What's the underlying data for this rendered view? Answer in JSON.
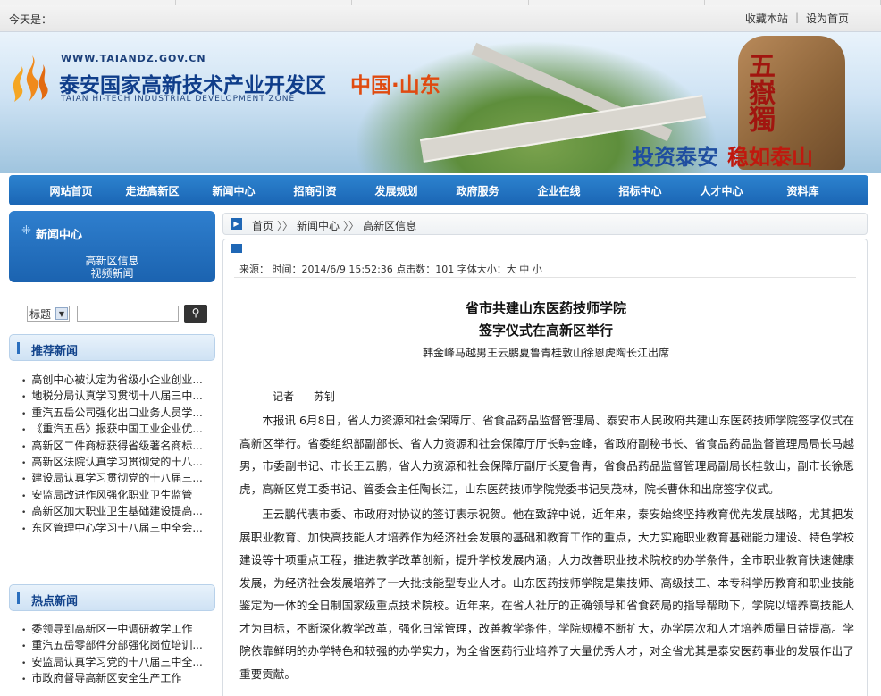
{
  "topbar": {
    "today_label": "今天是：",
    "favorite": "收藏本站",
    "separator": "|",
    "homepage": "设为首页"
  },
  "banner": {
    "url": "WWW.TAIANDZ.GOV.CN",
    "title_cn": "泰安国家高新技术产业开发区",
    "region": "中国·山东",
    "title_en": "TAIAN HI-TECH INDUSTRIAL DEVELOPMENT ZONE",
    "rock_text": "五嶽獨",
    "slogan_a": "投资泰安",
    "slogan_b": "稳如泰山",
    "accent_color": "#1a65b4"
  },
  "nav": [
    "网站首页",
    "走进高新区",
    "新闻中心",
    "招商引资",
    "发展规划",
    "政府服务",
    "企业在线",
    "招标中心",
    "人才中心",
    "资料库"
  ],
  "sidebar": {
    "section_title": "新闻中心",
    "sub_links": [
      "高新区信息",
      "视频新闻"
    ],
    "search": {
      "select_value": "标题",
      "button_icon": "search-icon"
    },
    "recommended": {
      "title": "推荐新闻",
      "items": [
        "高创中心被认定为省级小企业创业...",
        "地税分局认真学习贯彻十八届三中...",
        "重汽五岳公司强化出口业务人员学...",
        "《重汽五岳》报获中国工业企业优...",
        "高新区二件商标获得省级著名商标...",
        "高新区法院认真学习贯彻党的十八...",
        "建设局认真学习贯彻党的十八届三...",
        "安监局改进作风强化职业卫生监管",
        "高新区加大职业卫生基础建设提高...",
        "东区管理中心学习十八届三中全会..."
      ]
    },
    "hot": {
      "title": "热点新闻",
      "items": [
        "委领导到高新区一中调研教学工作",
        "重汽五岳零部件分部强化岗位培训...",
        "安监局认真学习党的十八届三中全...",
        "市政府督导高新区安全生产工作"
      ]
    }
  },
  "breadcrumb": {
    "items": [
      "首页",
      "新闻中心",
      "高新区信息"
    ],
    "sep": "〉〉"
  },
  "article": {
    "meta": "来源：  时间：2014/6/9 15:52:36 点击数：101   字体大小：大 中 小",
    "title_line1": "省市共建山东医药技师学院",
    "title_line2": "签字仪式在高新区举行",
    "subtitle": "韩金峰马越男王云鹏夏鲁青桂敦山徐恩虎陶长江出席",
    "reporter_label": "记者",
    "reporter_name": "苏钊",
    "paragraphs": [
      "本报讯  6月8日，省人力资源和社会保障厅、省食品药品监督管理局、泰安市人民政府共建山东医药技师学院签字仪式在高新区举行。省委组织部副部长、省人力资源和社会保障厅厅长韩金峰，省政府副秘书长、省食品药品监督管理局局长马越男，市委副书记、市长王云鹏，省人力资源和社会保障厅副厅长夏鲁青，省食品药品监督管理局副局长桂敦山，副市长徐恩虎，高新区党工委书记、管委会主任陶长江，山东医药技师学院党委书记吴茂林，院长曹休和出席签字仪式。",
      "王云鹏代表市委、市政府对协议的签订表示祝贺。他在致辞中说，近年来，泰安始终坚持教育优先发展战略，尤其把发展职业教育、加快高技能人才培养作为经济社会发展的基础和教育工作的重点，大力实施职业教育基础能力建设、特色学校建设等十项重点工程，推进教学改革创新，提升学校发展内涵，大力改善职业技术院校的办学条件，全市职业教育快速健康发展，为经济社会发展培养了一大批技能型专业人才。山东医药技师学院是集技师、高级技工、本专科学历教育和职业技能鉴定为一体的全日制国家级重点技术院校。近年来，在省人社厅的正确领导和省食药局的指导帮助下，学院以培养高技能人才为目标，不断深化教学改革，强化日常管理，改善教学条件，学院规模不断扩大，办学层次和人才培养质量日益提高。学院依靠鲜明的办学特色和较强的办学实力，为全省医药行业培养了大量优秀人才，对全省尤其是泰安医药事业的发展作出了重要贡献。"
    ]
  }
}
